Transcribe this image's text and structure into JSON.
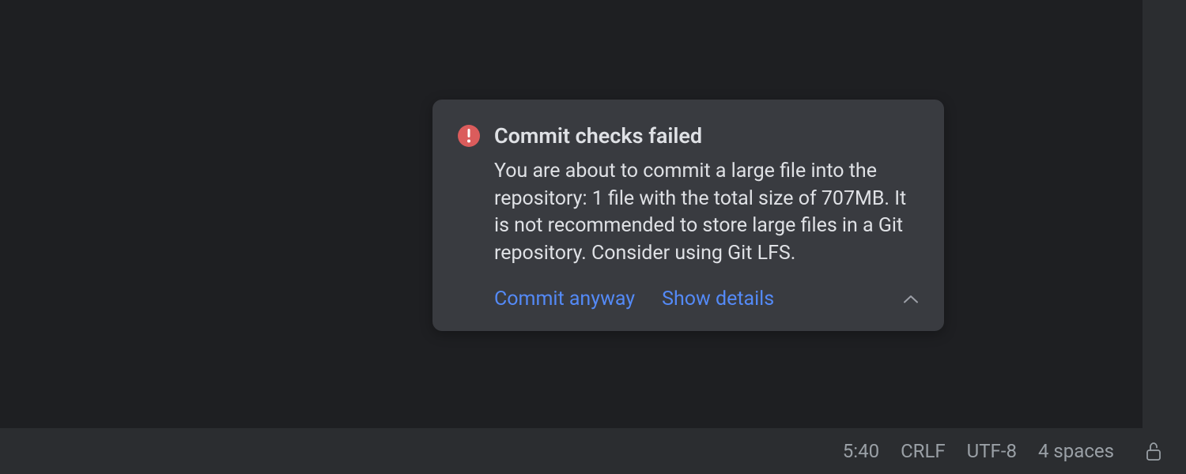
{
  "notification": {
    "title": "Commit checks failed",
    "body": "You are about to commit a large file into the repository: 1 file with the total size of 707MB. It is not recommended to store large files in a Git repository. Consider using Git LFS.",
    "actions": {
      "commit_anyway": "Commit anyway",
      "show_details": "Show details"
    }
  },
  "statusBar": {
    "cursor_position": "5:40",
    "line_separator": "CRLF",
    "encoding": "UTF-8",
    "indent": "4 spaces"
  }
}
